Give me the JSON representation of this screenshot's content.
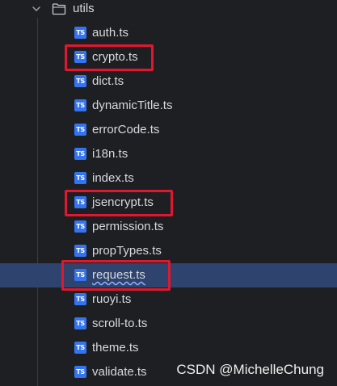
{
  "folder": {
    "name": "utils",
    "chevron_icon": "chevron-down-icon",
    "folder_icon": "folder-icon"
  },
  "files": [
    {
      "name": "auth.ts",
      "icon_text": "TS"
    },
    {
      "name": "crypto.ts",
      "icon_text": "TS",
      "highlighted": true
    },
    {
      "name": "dict.ts",
      "icon_text": "TS"
    },
    {
      "name": "dynamicTitle.ts",
      "icon_text": "TS"
    },
    {
      "name": "errorCode.ts",
      "icon_text": "TS"
    },
    {
      "name": "i18n.ts",
      "icon_text": "TS"
    },
    {
      "name": "index.ts",
      "icon_text": "TS"
    },
    {
      "name": "jsencrypt.ts",
      "icon_text": "TS",
      "highlighted": true
    },
    {
      "name": "permission.ts",
      "icon_text": "TS"
    },
    {
      "name": "propTypes.ts",
      "icon_text": "TS"
    },
    {
      "name": "request.ts",
      "icon_text": "TS",
      "highlighted": true,
      "selected": true
    },
    {
      "name": "ruoyi.ts",
      "icon_text": "TS"
    },
    {
      "name": "scroll-to.ts",
      "icon_text": "TS"
    },
    {
      "name": "theme.ts",
      "icon_text": "TS"
    },
    {
      "name": "validate.ts",
      "icon_text": "TS"
    }
  ],
  "watermark": "CSDN @MichelleChung",
  "colors": {
    "background": "#1e1f22",
    "selection": "#2e436e",
    "ts_icon": "#3574f0",
    "highlight_border": "#e0182f",
    "text": "#d7d9de"
  }
}
